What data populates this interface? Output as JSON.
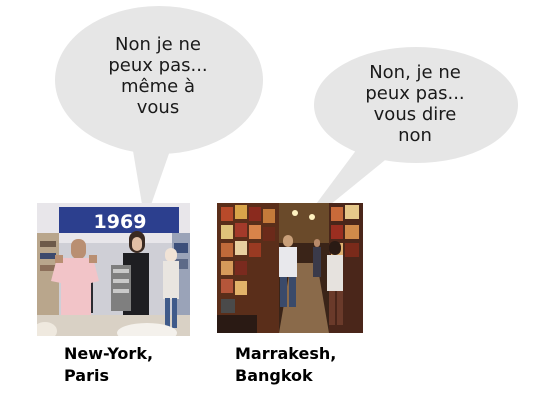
{
  "bubbles": [
    {
      "lines": [
        "Non je ne",
        "peux pas...",
        "même à",
        "vous"
      ]
    },
    {
      "lines": [
        "Non, je ne",
        "peux pas...",
        "vous dire",
        "non"
      ]
    }
  ],
  "captions": [
    {
      "lines": [
        "New-York,",
        "Paris"
      ]
    },
    {
      "lines": [
        "Marrakesh,",
        "Bangkok"
      ]
    }
  ],
  "photos": [
    {
      "subject": "clothing store with a man holding up a pink sweater and a woman beside him, store sign reading 1969",
      "sign_text": "1969"
    },
    {
      "subject": "crowded market alley lined with hanging leather bags and goods, people walking"
    }
  ],
  "colors": {
    "bubble_fill": "#e6e6e6",
    "text": "#1a1a1a",
    "caption": "#000000"
  }
}
